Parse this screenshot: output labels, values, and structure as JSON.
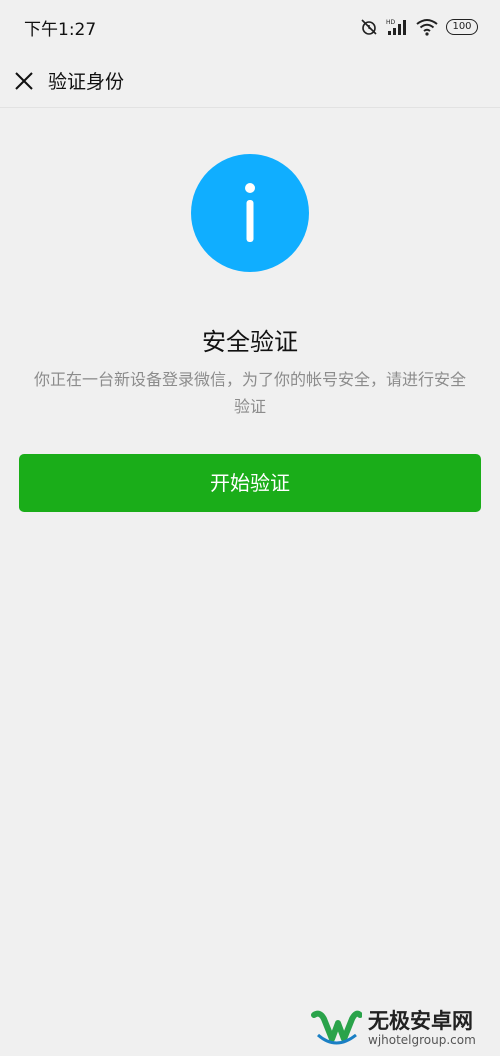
{
  "status_bar": {
    "time": "下午1:27",
    "icons": [
      "alarm-off-icon",
      "hd-signal-icon",
      "wifi-icon",
      "battery-icon"
    ],
    "battery": "100"
  },
  "nav": {
    "title": "验证身份",
    "close_icon": "close-icon"
  },
  "content": {
    "icon": "info-icon",
    "icon_color": "#10aeff",
    "title": "安全验证",
    "description": "你正在一台新设备登录微信，为了你的帐号安全，请进行安全验证",
    "button_label": "开始验证",
    "button_color": "#1aad19"
  },
  "watermark": {
    "name": "无极安卓网",
    "url": "wjhotelgroup.com"
  }
}
